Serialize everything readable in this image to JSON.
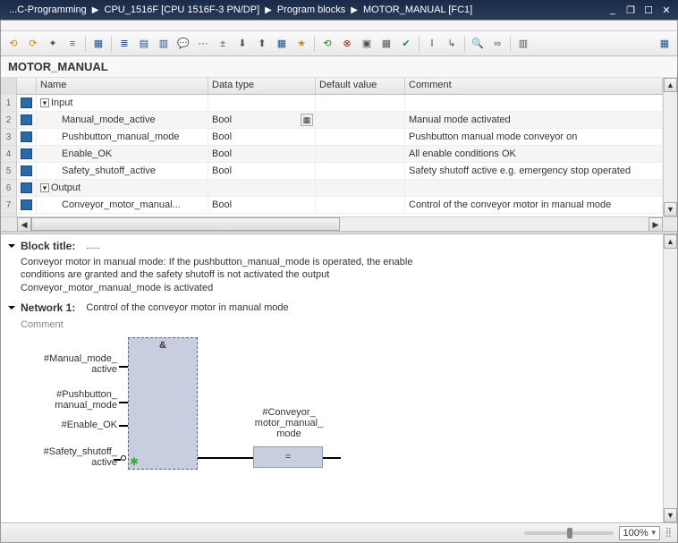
{
  "titlebar": {
    "crumbs": [
      "...C-Programming",
      "CPU_1516F [CPU 1516F-3 PN/DP]",
      "Program blocks",
      "MOTOR_MANUAL [FC1]"
    ]
  },
  "block_name": "MOTOR_MANUAL",
  "columns": {
    "name": "Name",
    "type": "Data type",
    "default": "Default value",
    "comment": "Comment"
  },
  "rows": [
    {
      "n": "1",
      "kind": "section",
      "name": "Input",
      "type": "",
      "comment": ""
    },
    {
      "n": "2",
      "kind": "param",
      "name": "Manual_mode_active",
      "type": "Bool",
      "comment": "Manual mode activated",
      "has_btn": true
    },
    {
      "n": "3",
      "kind": "param",
      "name": "Pushbutton_manual_mode",
      "type": "Bool",
      "comment": "Pushbutton manual mode conveyor on"
    },
    {
      "n": "4",
      "kind": "param",
      "name": "Enable_OK",
      "type": "Bool",
      "comment": "All enable conditions OK"
    },
    {
      "n": "5",
      "kind": "param",
      "name": "Safety_shutoff_active",
      "type": "Bool",
      "comment": "Safety shutoff active e.g. emergency stop operated"
    },
    {
      "n": "6",
      "kind": "section",
      "name": "Output",
      "type": "",
      "comment": ""
    },
    {
      "n": "7",
      "kind": "param",
      "name": "Conveyor_motor_manual...",
      "type": "Bool",
      "comment": "Control of the conveyor motor in manual mode"
    }
  ],
  "block_title_label": "Block title:",
  "block_title_rest": ".....",
  "block_desc": "Conveyor motor in manual mode: If the pushbutton_manual_mode is operated, the enable\nconditions are granted and the safety shutoff is not activated the output\nConveyor_motor_manual_mode is activated",
  "network": {
    "label": "Network 1:",
    "title": "Control of the conveyor motor in manual mode",
    "comment_label": "Comment",
    "and_symbol": "&",
    "assign_symbol": "=",
    "inputs": [
      "#Manual_mode_\nactive",
      "#Pushbutton_\nmanual_mode",
      "#Enable_OK",
      "#Safety_shutoff_\nactive"
    ],
    "output": "#Conveyor_\nmotor_manual_\nmode"
  },
  "zoom": "100%"
}
